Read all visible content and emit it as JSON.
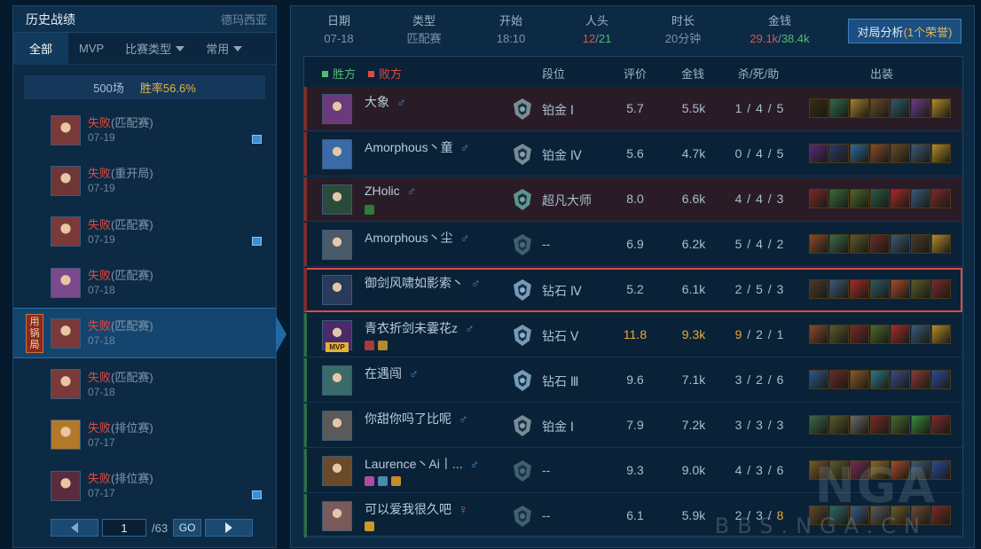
{
  "left": {
    "title": "历史战绩",
    "server": "德玛西亚",
    "tabs": [
      {
        "label": "全部",
        "dropdown": false
      },
      {
        "label": "MVP",
        "dropdown": false
      },
      {
        "label": "比赛类型",
        "dropdown": true
      },
      {
        "label": "常用",
        "dropdown": true
      }
    ],
    "summary": {
      "games": "500场",
      "winrate": "胜率56.6%"
    },
    "matches": [
      {
        "result": "失败",
        "mode": "(匹配赛)",
        "date": "07-19",
        "flag": true,
        "color": "#7a3a3a"
      },
      {
        "result": "失败",
        "mode": "(重开局)",
        "date": "07-19",
        "flag": false,
        "color": "#6e3636"
      },
      {
        "result": "失败",
        "mode": "(匹配赛)",
        "date": "07-19",
        "flag": true,
        "color": "#7a3a3a"
      },
      {
        "result": "失败",
        "mode": "(匹配赛)",
        "date": "07-18",
        "flag": false,
        "color": "#7b4a8c"
      },
      {
        "result": "失败",
        "mode": "(匹配赛)",
        "date": "07-18",
        "flag": false,
        "color": "#7a3a3a",
        "selected": true,
        "tag": "用锅局"
      },
      {
        "result": "失败",
        "mode": "(匹配赛)",
        "date": "07-18",
        "flag": false,
        "color": "#7a3a3a"
      },
      {
        "result": "失败",
        "mode": "(排位赛)",
        "date": "07-17",
        "flag": false,
        "color": "#b3792a"
      },
      {
        "result": "失败",
        "mode": "(排位赛)",
        "date": "07-17",
        "flag": true,
        "color": "#5a2b3e"
      }
    ],
    "pager": {
      "page": "1",
      "total": "/63",
      "go": "GO"
    }
  },
  "header": {
    "date_label": "日期",
    "date": "07-18",
    "type_label": "类型",
    "type": "匹配赛",
    "start_label": "开始",
    "start": "18:10",
    "kills_label": "人头",
    "kills_red": "12",
    "kills_sep": "/",
    "kills_green": "21",
    "dur_label": "时长",
    "duration": "20分钟",
    "gold_label": "金钱",
    "gold_red": "29.1k",
    "gold_sep": "/",
    "gold_green": "38.4k",
    "analysis_label": "对局分析",
    "analysis_honor": "(1个荣誉)"
  },
  "table": {
    "win_label": "胜方",
    "lose_label": "败方",
    "col_rank": "段位",
    "col_score": "评价",
    "col_gold": "金钱",
    "col_kda": "杀/死/助",
    "col_items": "出装",
    "rows": [
      {
        "name": "大象",
        "gender": "♂",
        "rank": "铂金 Ⅰ",
        "score": "5.7",
        "gold": "5.5k",
        "k": "1",
        "d": "4",
        "a": "5",
        "side": "lose",
        "avatar": "#6a3a7a",
        "rankcolor": "#8aa0a6",
        "items": [
          "#3b2b12",
          "#2f6b4a",
          "#a4822f",
          "#6a4a2a",
          "#2c5a6e",
          "#6b3c8a",
          "#b38b2a"
        ]
      },
      {
        "name": "Amorphous丶童",
        "gender": "♂",
        "rank": "铂金 Ⅳ",
        "score": "5.6",
        "gold": "4.7k",
        "k": "0",
        "d": "4",
        "a": "5",
        "side": "lose",
        "avatar": "#3a6aa8",
        "rankcolor": "#8aa0a6",
        "items": [
          "#5a2a7a",
          "#2a3a6a",
          "#2a6aa8",
          "#8a4a2a",
          "#6a4a2a",
          "#3a5a7a",
          "#b38b2a"
        ]
      },
      {
        "name": "ZHolic",
        "gender": "♂",
        "rank": "超凡大师",
        "score": "8.0",
        "gold": "6.6k",
        "k": "4",
        "d": "4",
        "a": "3",
        "side": "lose",
        "avatar": "#2a4a3a",
        "rankcolor": "#6aa8a0",
        "badges": [
          "#2e7d3a"
        ],
        "items": [
          "#7a2a2a",
          "#3a6a3a",
          "#4a6a2a",
          "#2a5a4a",
          "#a82a2a",
          "#3a5a7a",
          "#7a2a2a"
        ]
      },
      {
        "name": "Amorphous丶尘",
        "gender": "♂",
        "rank": "--",
        "score": "6.9",
        "gold": "6.2k",
        "k": "5",
        "d": "4",
        "a": "2",
        "side": "lose",
        "avatar": "#4a5a6a",
        "rankcolor": "#4a6a7a",
        "items": [
          "#8a4a2a",
          "#3a6a4a",
          "#5a5a2a",
          "#6a2a2a",
          "#3a5a7a",
          "#4a3a2a",
          "#b38b2a"
        ]
      },
      {
        "name": "御剑风啸如影索丶",
        "gender": "♂",
        "rank": "钻石 Ⅳ",
        "score": "5.2",
        "gold": "6.1k",
        "k": "2",
        "d": "5",
        "a": "3",
        "side": "lose",
        "avatar": "#2a3a5a",
        "rankcolor": "#8ab0d0",
        "highlight": true,
        "items": [
          "#4a3a2a",
          "#3a5a7a",
          "#a82a2a",
          "#2a5a6a",
          "#a84a2a",
          "#5a5a2a",
          "#7a2a2a"
        ]
      },
      {
        "name": "青衣折剑未霎花z",
        "gender": "♂",
        "rank": "钻石 Ⅴ",
        "score": "11.8",
        "gold": "9.3k",
        "k": "9",
        "d": "2",
        "a": "1",
        "side": "win",
        "mvp": true,
        "gold_hl": true,
        "avatar": "#4a2a6a",
        "rankcolor": "#8ab0d0",
        "badges": [
          "#a83a3a",
          "#b38b2a"
        ],
        "items": [
          "#8a4a2a",
          "#5a5a2a",
          "#7a2a2a",
          "#4a6a2a",
          "#a82a2a",
          "#3a5a7a",
          "#b38b2a"
        ]
      },
      {
        "name": "在遇闯",
        "gender": "♂",
        "rank": "钻石 Ⅲ",
        "score": "9.6",
        "gold": "7.1k",
        "k": "3",
        "d": "2",
        "a": "6",
        "side": "win",
        "avatar": "#3a6a6a",
        "rankcolor": "#8ab0d0",
        "items": [
          "#2a5a8a",
          "#6a2a2a",
          "#8a5a2a",
          "#2a7a8a",
          "#3a4a8a",
          "#8a3a3a",
          "#2a4a9a"
        ]
      },
      {
        "name": "你甜你吗了比呢",
        "gender": "♂",
        "rank": "铂金 Ⅰ",
        "score": "7.9",
        "gold": "7.2k",
        "k": "3",
        "d": "3",
        "a": "3",
        "side": "win",
        "avatar": "#5a5a5a",
        "rankcolor": "#8aa0a6",
        "items": [
          "#3a6a4a",
          "#5a5a2a",
          "#6a6a6a",
          "#7a2a2a",
          "#4a6a2a",
          "#3a8a3a",
          "#7a2a2a"
        ]
      },
      {
        "name": "Laurence丶Ai丨...",
        "gender": "♂",
        "rank": "--",
        "score": "9.3",
        "gold": "9.0k",
        "k": "4",
        "d": "3",
        "a": "6",
        "side": "win",
        "avatar": "#6a4a2a",
        "rankcolor": "#4a6a7a",
        "badges": [
          "#b24aa0",
          "#4a8ab0",
          "#c88a2a"
        ],
        "items": [
          "#7a5a2a",
          "#5a5a2a",
          "#7a2a5a",
          "#8a6a2a",
          "#a84a2a",
          "#3a5a7a",
          "#2a4a9a"
        ]
      },
      {
        "name": "可以爱我很久吧",
        "gender": "♀",
        "rank": "--",
        "score": "6.1",
        "gold": "5.9k",
        "k": "2",
        "d": "3",
        "a": "8",
        "side": "win",
        "assist_hl": true,
        "avatar": "#7a5a5a",
        "rankcolor": "#4a6a7a",
        "badges": [
          "#c89a2a"
        ],
        "items": [
          "#5a4a2a",
          "#2a6a6a",
          "#3a5a8a",
          "#5a5a5a",
          "#6a5a2a",
          "#6a4a3a",
          "#7a2a2a"
        ]
      }
    ]
  },
  "watermark": {
    "logo": "NGA",
    "site": "BBS.NGA.CN"
  },
  "colors": {
    "lose": "#e04a3f",
    "win": "#59b870",
    "gold": "#e7a93a",
    "accent": "#1f6aa5"
  }
}
